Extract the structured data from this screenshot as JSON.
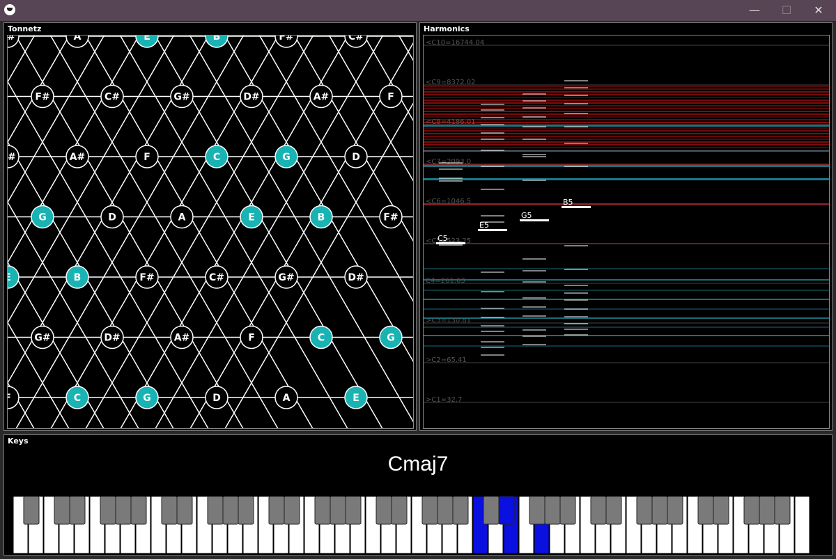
{
  "window": {
    "minimize_glyph": "—",
    "maximize_glyph": "☐",
    "close_glyph": "✕"
  },
  "tonnetz": {
    "title": "Tonnetz",
    "rows": [
      {
        "notes": [
          "C#",
          "A",
          "E",
          "B",
          "F#",
          "C#"
        ],
        "highlight": [
          false,
          false,
          true,
          true,
          false,
          false
        ]
      },
      {
        "notes": [
          "F#",
          "C#",
          "G#",
          "D#",
          "A#",
          "F"
        ],
        "highlight": [
          false,
          false,
          false,
          false,
          false,
          false
        ]
      },
      {
        "notes": [
          "D#",
          "A#",
          "F",
          "C",
          "G",
          "D"
        ],
        "highlight": [
          false,
          false,
          false,
          true,
          true,
          false
        ]
      },
      {
        "notes": [
          "G",
          "D",
          "A",
          "E",
          "B",
          "F#"
        ],
        "highlight": [
          true,
          false,
          false,
          true,
          true,
          false
        ]
      },
      {
        "notes": [
          "E",
          "B",
          "F#",
          "C#",
          "G#",
          "D#"
        ],
        "highlight": [
          true,
          true,
          false,
          false,
          false,
          false
        ]
      },
      {
        "notes": [
          "G#",
          "D#",
          "A#",
          "F",
          "C",
          "G"
        ],
        "highlight": [
          false,
          false,
          false,
          false,
          true,
          true
        ]
      },
      {
        "notes": [
          "F",
          "C",
          "G",
          "D",
          "A",
          "E"
        ],
        "highlight": [
          false,
          true,
          true,
          false,
          false,
          true
        ]
      }
    ],
    "highlight_color": "#19b3b3"
  },
  "harmonics": {
    "title": "Harmonics",
    "octave_labels": [
      "<C10=16744.04",
      "<C9=8372.02",
      "<C8=4186.01",
      "<C7=2093.0",
      "<C6=1046.5",
      "<C5=523.25",
      "C4=261.63",
      ">C3=130.81",
      ">C2=65.41",
      ">C1=32.7"
    ],
    "notes": [
      "C5",
      "E5",
      "G5",
      "B5"
    ],
    "red_color": "#b01010",
    "teal_color": "#1c8a9a"
  },
  "keys": {
    "title": "Keys",
    "chord": "Cmaj7",
    "pressed_color": "#0a10e0"
  }
}
